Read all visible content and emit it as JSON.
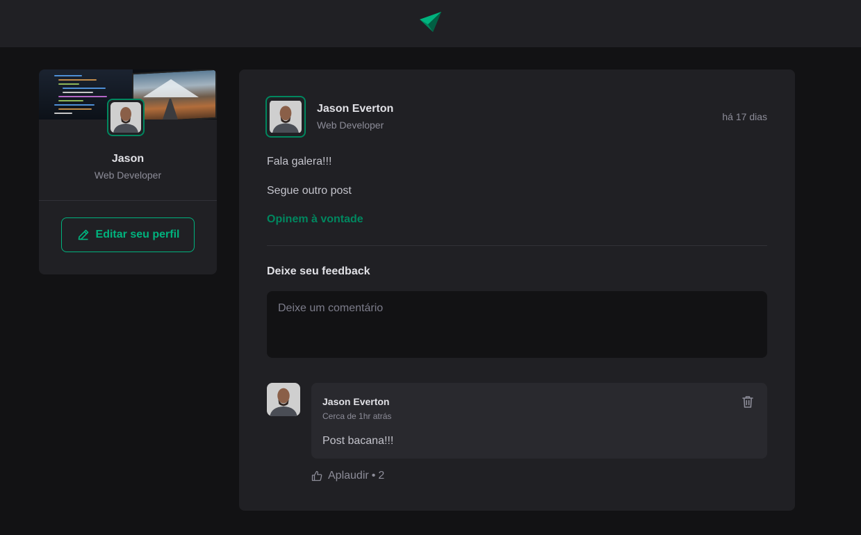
{
  "header": {
    "logo_icon": "paper-plane-logo-icon",
    "brand_color": "#00875f"
  },
  "sidebar": {
    "cover_image": "developer-workspace-cover",
    "name": "Jason",
    "role": "Web Developer",
    "edit_button": {
      "label": "Editar seu perfil",
      "icon": "pencil-icon"
    }
  },
  "post": {
    "author": "Jason Everton",
    "role": "Web Developer",
    "time": "há 17 dias",
    "paragraphs": [
      "Fala galera!!!",
      "Segue outro post"
    ],
    "link_text": "Opinem à vontade",
    "feedback_title": "Deixe seu feedback",
    "comment_placeholder": "Deixe um comentário"
  },
  "comment": {
    "author": "Jason Everton",
    "time": "Cerca de 1hr atrás",
    "text": "Post bacana!!!",
    "delete_icon": "trash-icon",
    "applaud_label": "Aplaudir",
    "applaud_count": "2",
    "applaud_separator": "•",
    "applaud_icon": "thumbs-up-icon"
  },
  "colors": {
    "background": "#121214",
    "surface": "#202024",
    "comment_surface": "#29292e",
    "accent": "#00875f",
    "accent_light": "#00b37e"
  }
}
